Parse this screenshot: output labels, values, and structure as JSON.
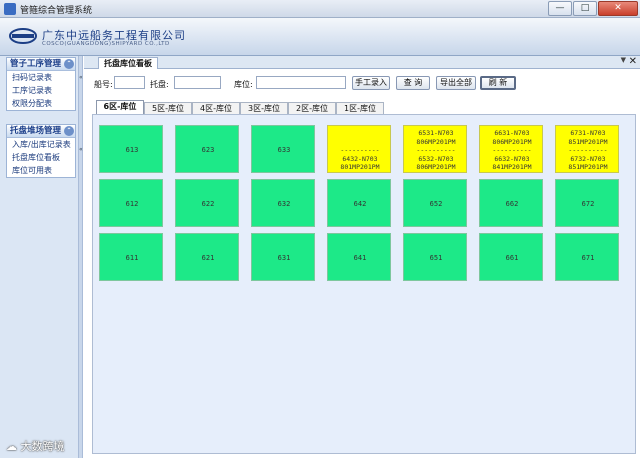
{
  "window": {
    "title": "管箍综合管理系统",
    "min": "—",
    "max": "□",
    "close": "✕"
  },
  "banner": {
    "company_cn": "广东中远船务工程有限公司",
    "company_en": "COSCO(GUANGDONG)SHIPYARD CO.,LTD"
  },
  "sidebar": {
    "sections": [
      {
        "title": "管子工序管理",
        "items": [
          "扫码记录表",
          "工序记录表",
          "权限分配表"
        ]
      },
      {
        "title": "托盘堆场管理",
        "items": [
          "入库/出库记录表",
          "托盘库位看板",
          "库位可用表"
        ]
      }
    ]
  },
  "doc_tab": {
    "label": "托盘库位看板",
    "close": "✕",
    "arrow": "▼"
  },
  "toolbar": {
    "ship_label": "船号:",
    "pallet_label": "托盘:",
    "location_label": "库位:",
    "ship_value": "",
    "pallet_value": "",
    "location_value": "",
    "manual_entry": "手工录入",
    "query": "查 询",
    "export_all": "导出全部",
    "refresh": "刷 新"
  },
  "zone_tabs": [
    "6区-库位",
    "5区-库位",
    "4区-库位",
    "3区-库位",
    "2区-库位",
    "1区-库位"
  ],
  "active_zone": "6区-库位",
  "colors": {
    "free": "#1de988",
    "occupied": "#ffff00"
  },
  "cells": [
    {
      "id": "613",
      "status": "free"
    },
    {
      "id": "623",
      "status": "free"
    },
    {
      "id": "633",
      "status": "free"
    },
    {
      "id": "643",
      "status": "occupied",
      "lines": [
        "",
        "",
        "----------",
        "6432-N703",
        "801MP201PM"
      ]
    },
    {
      "id": "653",
      "status": "occupied",
      "lines": [
        "6531-N703",
        "806MP201PM",
        "----------",
        "6532-N703",
        "806MP201PM"
      ]
    },
    {
      "id": "663",
      "status": "occupied",
      "lines": [
        "6631-N703",
        "806MP201PM",
        "----------",
        "6632-N703",
        "841MP201PM"
      ]
    },
    {
      "id": "673",
      "status": "occupied",
      "lines": [
        "6731-N703",
        "851MP201PM",
        "----------",
        "6732-N703",
        "851MP201PM"
      ]
    },
    {
      "id": "612",
      "status": "free"
    },
    {
      "id": "622",
      "status": "free"
    },
    {
      "id": "632",
      "status": "free"
    },
    {
      "id": "642",
      "status": "free"
    },
    {
      "id": "652",
      "status": "free"
    },
    {
      "id": "662",
      "status": "free"
    },
    {
      "id": "672",
      "status": "free"
    },
    {
      "id": "611",
      "status": "free"
    },
    {
      "id": "621",
      "status": "free"
    },
    {
      "id": "631",
      "status": "free"
    },
    {
      "id": "641",
      "status": "free"
    },
    {
      "id": "651",
      "status": "free"
    },
    {
      "id": "661",
      "status": "free"
    },
    {
      "id": "671",
      "status": "free"
    }
  ],
  "watermark": "大数跨境"
}
